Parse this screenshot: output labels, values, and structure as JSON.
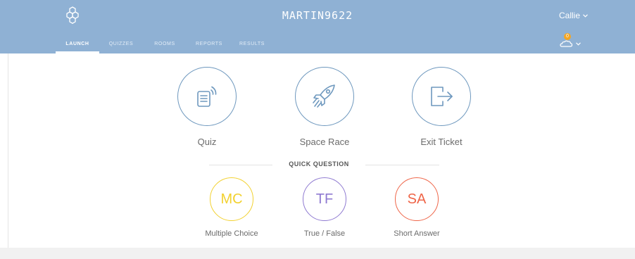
{
  "header": {
    "room_name": "MARTIN9622",
    "user_name": "Callie",
    "notification_count": "0",
    "tabs": [
      {
        "label": "LAUNCH",
        "active": true
      },
      {
        "label": "QUIZZES",
        "active": false
      },
      {
        "label": "ROOMS",
        "active": false
      },
      {
        "label": "REPORTS",
        "active": false
      },
      {
        "label": "RESULTS",
        "active": false
      }
    ]
  },
  "launch": {
    "items": [
      {
        "label": "Quiz",
        "icon": "quiz-icon"
      },
      {
        "label": "Space Race",
        "icon": "rocket-icon"
      },
      {
        "label": "Exit Ticket",
        "icon": "exit-icon"
      }
    ]
  },
  "quick_question": {
    "title": "QUICK QUESTION",
    "items": [
      {
        "abbr": "MC",
        "label": "Multiple Choice",
        "color": "#f2d12f"
      },
      {
        "abbr": "TF",
        "label": "True / False",
        "color": "#8f7ad1"
      },
      {
        "abbr": "SA",
        "label": "Short Answer",
        "color": "#ef6548"
      }
    ]
  },
  "colors": {
    "header": "#8fb1d4",
    "launch_circle": "#6e98be",
    "badge": "#f5a623"
  }
}
